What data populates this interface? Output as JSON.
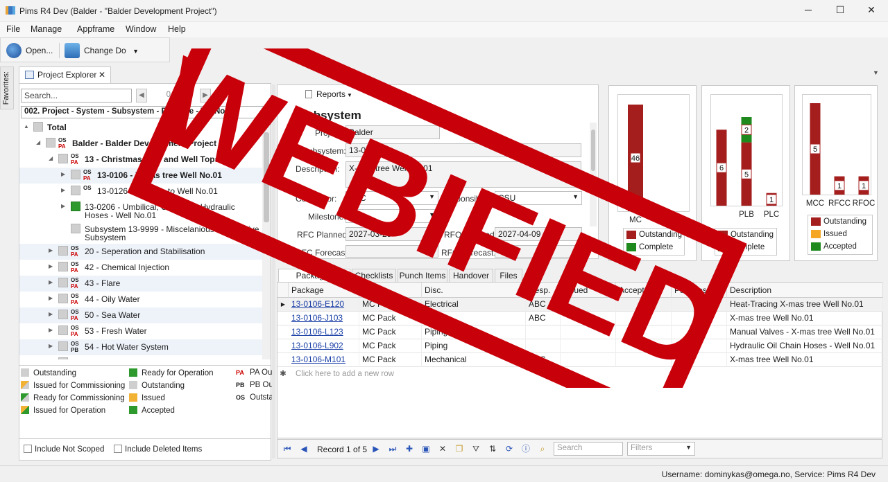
{
  "window": {
    "title": "Pims R4 Dev (Balder - \"Balder Development Project\")",
    "min": "─",
    "max": "☐",
    "close": "✕"
  },
  "menu": [
    "File",
    "Manage",
    "Appframe",
    "Window",
    "Help"
  ],
  "toolbar": {
    "open": "Open...",
    "change": "Change Do"
  },
  "favorites": "Favorites:",
  "explorer": {
    "tab": "Project Explorer",
    "search_placeholder": "Search...",
    "pager": "0 of 0",
    "hierarchy": "002. Project - System - Subsystem - Package - TagNo",
    "tree": [
      {
        "label": "Total",
        "bold": true,
        "indent": 0,
        "exp": "▲",
        "badges": []
      },
      {
        "label": "Balder - Balder Development Project",
        "bold": true,
        "indent": 1,
        "exp": "◢",
        "badges": [
          "OS",
          "PA"
        ]
      },
      {
        "label": "13 - Christmas Tree and Well Topside",
        "bold": true,
        "indent": 2,
        "exp": "◢",
        "badges": [
          "OS",
          "PA"
        ]
      },
      {
        "label": "13-0106 - X-mas tree Well No.01",
        "bold": true,
        "indent": 3,
        "exp": "▶",
        "badges": [
          "OS",
          "PA"
        ],
        "alt": true
      },
      {
        "label": "13-0126 - Flowline to Well No.01",
        "bold": false,
        "indent": 3,
        "exp": "▶",
        "badges": [
          "OS"
        ]
      },
      {
        "label": "13-0206 - Umbilical, Chemical, Hydraulic",
        "label2": "Hoses - Well No.01",
        "bold": false,
        "indent": 3,
        "exp": "▶",
        "badges": [],
        "green": true
      },
      {
        "label": "Subsystem 13-9999 - Miscelanious - Excessive",
        "label2": "Subsystem",
        "bold": false,
        "indent": 3,
        "exp": "",
        "badges": []
      },
      {
        "label": "20 - Seperation and Stabilisation",
        "bold": false,
        "indent": 2,
        "exp": "▶",
        "badges": [
          "OS",
          "PA"
        ],
        "alt": true
      },
      {
        "label": "42 - Chemical Injection",
        "bold": false,
        "indent": 2,
        "exp": "▶",
        "badges": [
          "OS",
          "PA"
        ]
      },
      {
        "label": "43 - Flare",
        "bold": false,
        "indent": 2,
        "exp": "▶",
        "badges": [
          "OS",
          "PA"
        ],
        "alt": true
      },
      {
        "label": "44 - Oily Water",
        "bold": false,
        "indent": 2,
        "exp": "▶",
        "badges": [
          "OS",
          "PA"
        ]
      },
      {
        "label": "50 - Sea Water",
        "bold": false,
        "indent": 2,
        "exp": "▶",
        "badges": [
          "OS",
          "PA"
        ],
        "alt": true
      },
      {
        "label": "53 - Fresh Water",
        "bold": false,
        "indent": 2,
        "exp": "▶",
        "badges": [
          "OS",
          "PA"
        ]
      },
      {
        "label": "54 - Hot Water System",
        "bold": false,
        "indent": 2,
        "exp": "▶",
        "badges": [
          "OS",
          "PB"
        ],
        "alt": true
      },
      {
        "label": "55 - Steam",
        "bold": false,
        "indent": 2,
        "exp": "▶",
        "badges": []
      }
    ],
    "legend_col1": [
      "Outstanding",
      "Issued for Commissioning",
      "Ready for Commissioning",
      "Issued for Operation"
    ],
    "legend_col2": [
      "Ready for Operation",
      "Outstanding",
      "Issued",
      "Accepted"
    ],
    "legend_col3": [
      {
        "badge": "PA",
        "label": "PA Ou"
      },
      {
        "badge": "PB",
        "label": "PB Ou"
      },
      {
        "badge": "OS",
        "label": "Outsta"
      }
    ],
    "include_not_scoped": "Include Not Scoped",
    "include_deleted": "Include Deleted Items"
  },
  "form": {
    "reports": "Reports",
    "title": "Subsystem",
    "project_label": "Project:",
    "project_value": "Balder",
    "subsystem_label": "Subsystem:",
    "subsystem_value": "13-0106",
    "description_label": "Description:",
    "description_value": "X-mas tree Well No.01",
    "contractor_label": "Contractor:",
    "contractor_value": "ABC",
    "responsible_label": "Responsible:",
    "responsible_value": "CSU",
    "milestone_label": "Milestone:",
    "milestone_value": "Sea",
    "rfc_planned_label": "RFC Planned:",
    "rfc_planned_value": "2027-03-29",
    "rfo_planned_label": "RFO Planned:",
    "rfo_planned_value": "2027-04-09",
    "rfc_forecast_label": "RFC Forecast:",
    "rfo_forecast_label": "RFO Forecast:"
  },
  "chart_data": [
    {
      "type": "bar",
      "categories": [
        "MC",
        "C"
      ],
      "series": [
        {
          "name": "Outstanding",
          "values": [
            46,
            0
          ]
        },
        {
          "name": "Complete",
          "values": [
            0,
            0
          ]
        }
      ],
      "data_labels": [
        "46"
      ],
      "legend": "bottom",
      "colors": {
        "Outstanding": "#a51e1e",
        "Complete": "#1e8a1e"
      }
    },
    {
      "type": "bar",
      "categories": [
        "",
        "PLB",
        "PLC"
      ],
      "series": [
        {
          "name": "Outstanding",
          "values": [
            6,
            5,
            1
          ]
        },
        {
          "name": "Complete",
          "values": [
            0,
            2,
            0
          ]
        }
      ],
      "data_labels": [
        "6",
        "5",
        "2",
        "1"
      ],
      "legend": "bottom",
      "colors": {
        "Outstanding": "#a51e1e",
        "Complete": "#1e8a1e"
      }
    },
    {
      "type": "bar",
      "categories": [
        "MCC",
        "RFCC",
        "RFOC"
      ],
      "series": [
        {
          "name": "Outstanding",
          "values": [
            5,
            1,
            1
          ]
        },
        {
          "name": "Issued",
          "values": [
            0,
            0,
            0
          ]
        },
        {
          "name": "Accepted",
          "values": [
            0,
            0,
            0
          ]
        }
      ],
      "data_labels": [
        "5",
        "1",
        "1"
      ],
      "legend": "bottom",
      "colors": {
        "Outstanding": "#a51e1e",
        "Issued": "#f5a623",
        "Accepted": "#1e8a1e"
      }
    }
  ],
  "tabs": [
    "Packages",
    "Checklists",
    "Punch Items",
    "Handover",
    "Files"
  ],
  "grid": {
    "columns": [
      "Package",
      "Type",
      "Disc.",
      "Resp.",
      "Issued",
      "Accepted",
      "Punches",
      "Description"
    ],
    "rows": [
      [
        "13-0106-E120",
        "MC Pack",
        "Electrical",
        "ABC",
        "",
        "",
        "",
        "Heat-Tracing X-mas tree Well No.01"
      ],
      [
        "13-0106-J103",
        "MC Pack",
        "",
        "ABC",
        "",
        "",
        "",
        "X-mas tree Well No.01"
      ],
      [
        "13-0106-L123",
        "MC Pack",
        "Piping",
        "",
        "",
        "",
        "",
        "Manual Valves - X-mas tree Well No.01"
      ],
      [
        "13-0106-L902",
        "MC Pack",
        "Piping",
        "",
        "",
        "",
        "",
        "Hydraulic Oil Chain Hoses - Well No.01"
      ],
      [
        "13-0106-M101",
        "MC Pack",
        "Mechanical",
        "ABC",
        "",
        "",
        "",
        "X-mas tree Well No.01"
      ]
    ],
    "new_row": "Click here to add a new row"
  },
  "navigator": {
    "record": "Record 1 of 5",
    "search_placeholder": "Search",
    "filters_placeholder": "Filters"
  },
  "status": "Username: dominykas@omega.no, Service: Pims R4 Dev",
  "stamp": "WEBIFIED"
}
